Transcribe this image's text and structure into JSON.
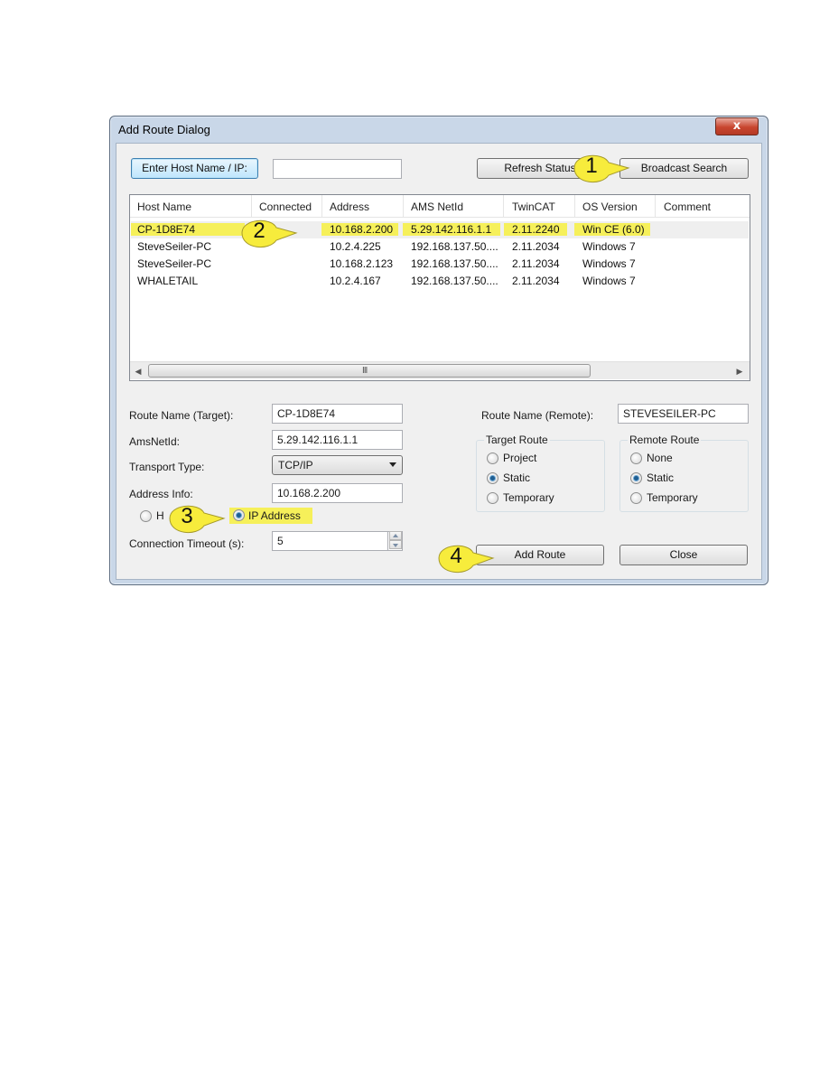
{
  "window": {
    "title": "Add Route Dialog",
    "close_glyph": "x"
  },
  "top_bar": {
    "enter_host_button": "Enter Host Name / IP:",
    "host_input_value": "",
    "refresh_status_button": "Refresh Status",
    "broadcast_search_button": "Broadcast Search"
  },
  "host_list": {
    "columns": [
      "Host Name",
      "Connected",
      "Address",
      "AMS NetId",
      "TwinCAT",
      "OS Version",
      "Comment"
    ],
    "rows": [
      {
        "host_name": "CP-1D8E74",
        "connected": "",
        "address": "10.168.2.200",
        "ams_netid": "5.29.142.116.1.1",
        "twincat": "2.11.2240",
        "os_version": "Win CE (6.0)",
        "comment": "",
        "selected": true
      },
      {
        "host_name": "SteveSeiler-PC",
        "connected": "",
        "address": "10.2.4.225",
        "ams_netid": "192.168.137.50....",
        "twincat": "2.11.2034",
        "os_version": "Windows 7",
        "comment": ""
      },
      {
        "host_name": "SteveSeiler-PC",
        "connected": "",
        "address": "10.168.2.123",
        "ams_netid": "192.168.137.50....",
        "twincat": "2.11.2034",
        "os_version": "Windows 7",
        "comment": ""
      },
      {
        "host_name": "WHALETAIL",
        "connected": "",
        "address": "10.2.4.167",
        "ams_netid": "192.168.137.50....",
        "twincat": "2.11.2034",
        "os_version": "Windows 7",
        "comment": ""
      }
    ],
    "scroll_grip": "III"
  },
  "form": {
    "route_name_target_label": "Route Name (Target):",
    "route_name_target_value": "CP-1D8E74",
    "ams_netid_label": "AmsNetId:",
    "ams_netid_value": "5.29.142.116.1.1",
    "transport_type_label": "Transport Type:",
    "transport_type_value": "TCP/IP",
    "address_info_label": "Address Info:",
    "address_info_value": "10.168.2.200",
    "host_name_radio_label": "Host Name",
    "host_name_radio_visible": "H",
    "ip_address_radio_label": "IP Address",
    "address_mode_selected": "IP Address",
    "connection_timeout_label": "Connection Timeout (s):",
    "connection_timeout_value": "5",
    "route_name_remote_label": "Route Name (Remote):",
    "route_name_remote_value": "STEVESEILER-PC"
  },
  "target_route": {
    "title": "Target Route",
    "options": [
      "Project",
      "Static",
      "Temporary"
    ],
    "selected": "Static"
  },
  "remote_route": {
    "title": "Remote Route",
    "options": [
      "None",
      "Static",
      "Temporary"
    ],
    "selected": "Static"
  },
  "actions": {
    "add_route_button": "Add Route",
    "close_button": "Close"
  },
  "callouts": [
    "1",
    "2",
    "3",
    "4"
  ],
  "colors": {
    "highlight": "#f6f05a",
    "callout_fill": "#f7ec3c",
    "close_button": "#c8452f",
    "window_frame": "#c9d7e8",
    "dialog_bg": "#f0f0f0"
  }
}
